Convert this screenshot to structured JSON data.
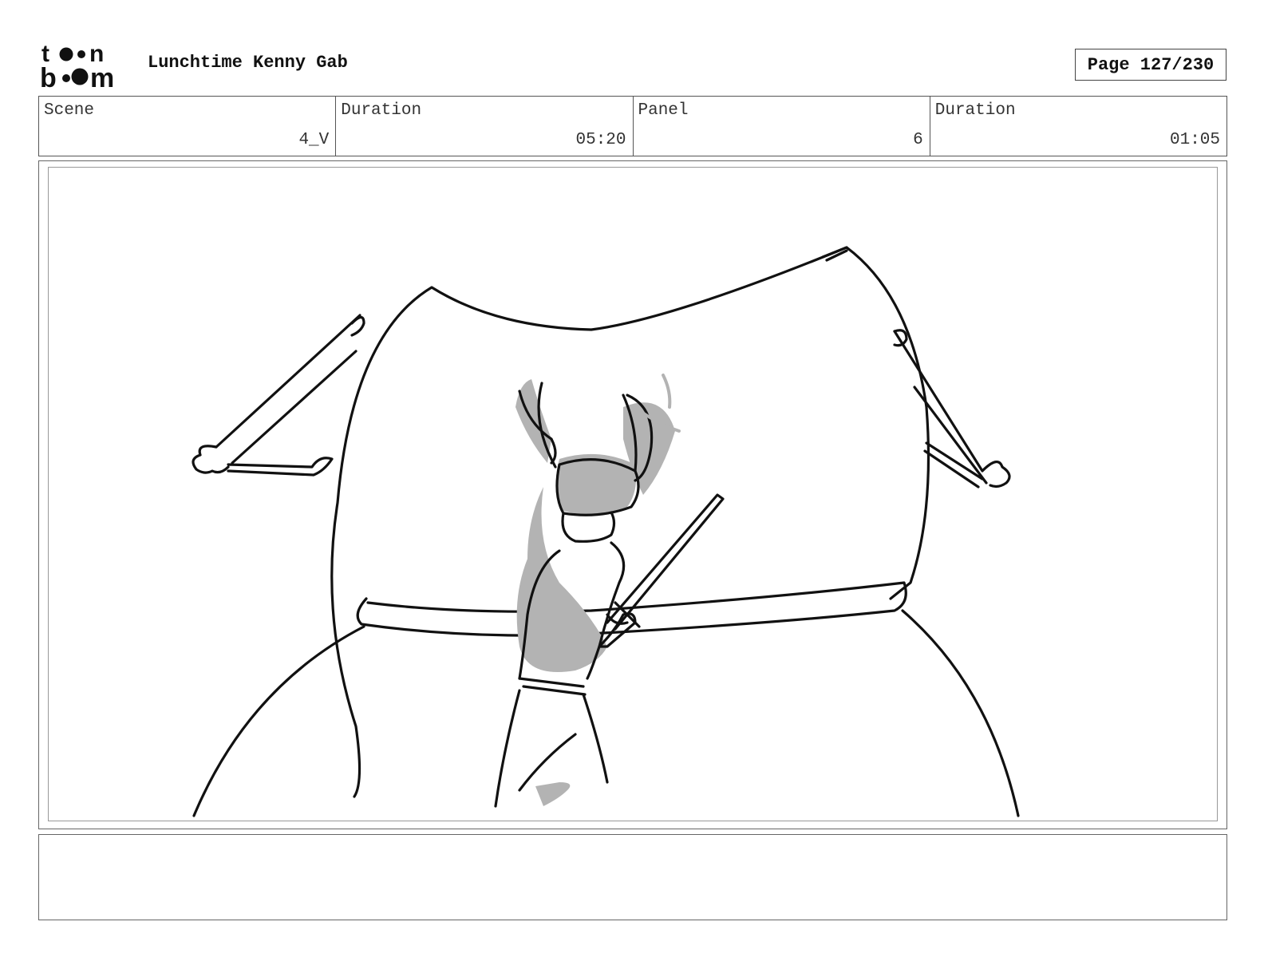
{
  "header": {
    "logo_icon": "toonboom-logo",
    "logo_top": "t",
    "logo_mid": "n",
    "logo_bottom_b": "b",
    "logo_bottom_m": "m",
    "title": "Lunchtime Kenny Gab",
    "page": "Page 127/230"
  },
  "info": {
    "scene_label": "Scene",
    "scene_value": "4_V",
    "scene_duration_label": "Duration",
    "scene_duration_value": "05:20",
    "panel_label": "Panel",
    "panel_value": "6",
    "panel_duration_label": "Duration",
    "panel_duration_value": "01:05"
  },
  "notes": {
    "text": ""
  },
  "colors": {
    "border": "#555555",
    "shade": "#b3b3b3",
    "ink": "#111111"
  }
}
